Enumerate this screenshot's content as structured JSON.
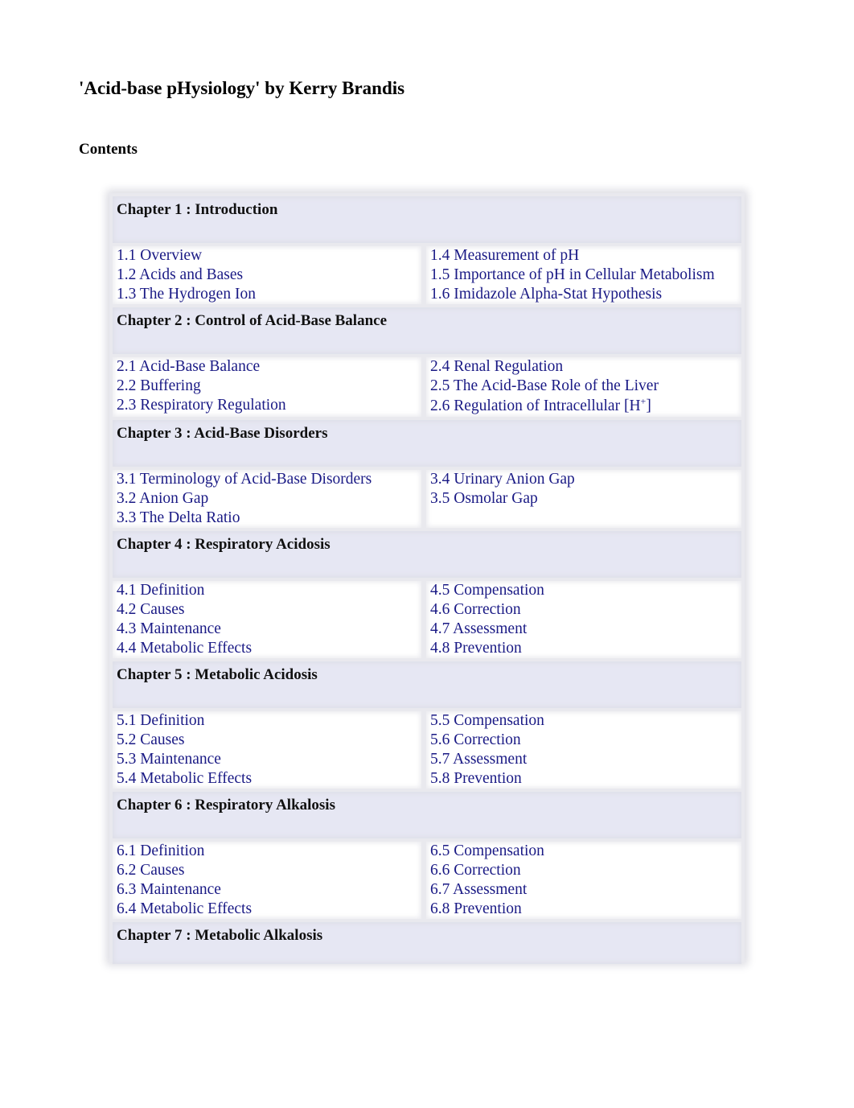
{
  "document": {
    "title": "'Acid-base pHysiology' by Kerry Brandis",
    "contents_heading": "Contents"
  },
  "chapters": [
    {
      "title": "Chapter 1 : Introduction",
      "left": [
        "1.1 Overview",
        "1.2 Acids and Bases",
        "1.3 The Hydrogen Ion"
      ],
      "right": [
        "1.4 Measurement of pH",
        "1.5 Importance of pH in Cellular Metabolism",
        "1.6 Imidazole Alpha-Stat Hypothesis"
      ]
    },
    {
      "title": "Chapter 2 : Control of Acid-Base Balance",
      "left": [
        "2.1 Acid-Base Balance",
        "2.2 Buffering",
        "2.3 Respiratory Regulation"
      ],
      "right": [
        "2.4 Renal Regulation",
        "2.5 The Acid-Base Role of the Liver",
        "2.6 Regulation of Intracellular [H"
      ],
      "right_sup": "+",
      "right_suffix": "]"
    },
    {
      "title": "Chapter 3 : Acid-Base Disorders",
      "left": [
        "3.1 Terminology of Acid-Base Disorders",
        "3.2 Anion Gap",
        "3.3 The Delta Ratio"
      ],
      "right": [
        "3.4 Urinary Anion Gap",
        "3.5 Osmolar Gap"
      ]
    },
    {
      "title": "Chapter 4 : Respiratory Acidosis",
      "left": [
        "4.1 Definition",
        "4.2 Causes",
        "4.3 Maintenance",
        "4.4 Metabolic Effects"
      ],
      "right": [
        "4.5 Compensation",
        "4.6 Correction",
        "4.7 Assessment",
        "4.8 Prevention"
      ]
    },
    {
      "title": "Chapter 5 : Metabolic Acidosis",
      "left": [
        "5.1 Definition",
        "5.2 Causes",
        "5.3 Maintenance",
        "5.4 Metabolic Effects"
      ],
      "right": [
        "5.5 Compensation",
        "5.6 Correction",
        "5.7 Assessment",
        "5.8 Prevention"
      ]
    },
    {
      "title": "Chapter 6 : Respiratory Alkalosis",
      "left": [
        "6.1 Definition",
        "6.2 Causes",
        "6.3 Maintenance",
        "6.4 Metabolic Effects"
      ],
      "right": [
        "6.5 Compensation",
        "6.6 Correction",
        "6.7 Assessment",
        "6.8 Prevention"
      ]
    },
    {
      "title": "Chapter 7 : Metabolic Alkalosis",
      "left": [],
      "right": []
    }
  ],
  "colors": {
    "link": "#1a1a85",
    "header_bg": "#e6e7f3",
    "text": "#000000"
  }
}
